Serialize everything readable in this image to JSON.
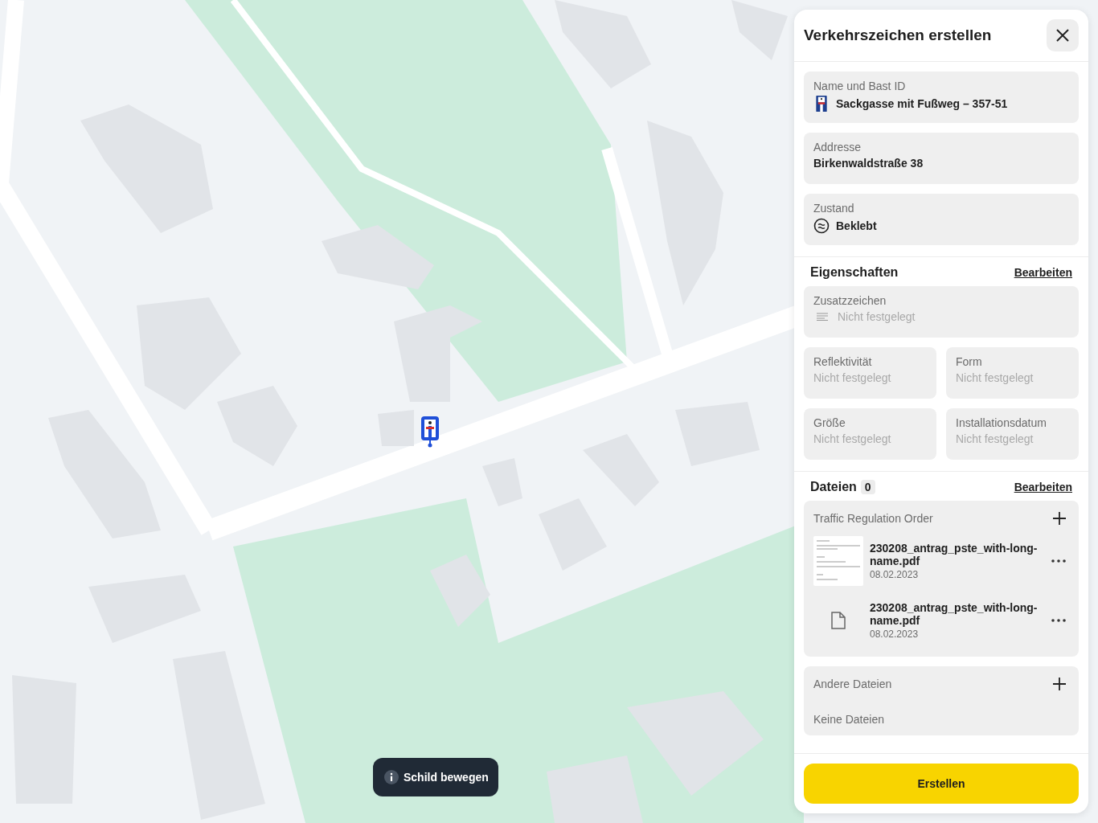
{
  "panel": {
    "title": "Verkehrszeichen erstellen",
    "fields": [
      {
        "label": "Name und Bast ID",
        "value": "Sackgasse mit Fußweg – 357-51",
        "kind": "sign"
      },
      {
        "label": "Addresse",
        "value": "Birkenwaldstraße 38",
        "kind": "text"
      },
      {
        "label": "Zustand",
        "value": "Beklebt",
        "kind": "status"
      }
    ],
    "properties": {
      "heading": "Eigenschaften",
      "edit_link": "Bearbeiten",
      "items": [
        {
          "label": "Zusatzzeichen",
          "value": "Nicht festgelegt",
          "kind": "wide"
        },
        {
          "label": "Reflektivität",
          "value": "Nicht festgelegt",
          "kind": "half"
        },
        {
          "label": "Form",
          "value": "Nicht festgelegt",
          "kind": "half"
        },
        {
          "label": "Größe",
          "value": "Nicht festgelegt",
          "kind": "half"
        },
        {
          "label": "Installationsdatum",
          "value": "Nicht festgelegt",
          "kind": "half"
        }
      ]
    },
    "files": {
      "heading": "Dateien",
      "count": "0",
      "edit_link": "Bearbeiten",
      "groups": [
        {
          "title": "Traffic Regulation Order",
          "files": [
            {
              "name": "230208_antrag_pste_with-long-name.pdf",
              "date": "08.02.2023",
              "kind": "thumbnail"
            },
            {
              "name": "230208_antrag_pste_with-long-name.pdf",
              "date": "08.02.2023",
              "kind": "generic"
            }
          ]
        },
        {
          "title": "Andere Dateien",
          "empty_text": "Keine Dateien"
        }
      ]
    },
    "submit": "Erstellen"
  },
  "toast": {
    "text": "Schild bewegen"
  }
}
